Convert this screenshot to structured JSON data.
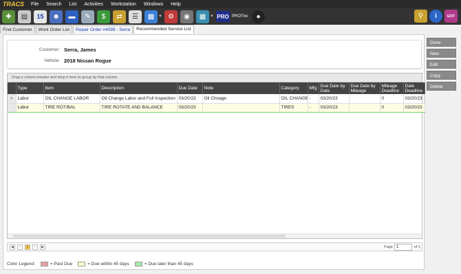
{
  "app": {
    "logo": "TRACS"
  },
  "menu": [
    "File",
    "Search",
    "List",
    "Activities",
    "Workstation",
    "Windows",
    "Help"
  ],
  "toolbar": {
    "icons": [
      "new-doc-icon",
      "clipboard-icon",
      "calendar-icon",
      "customers-icon",
      "car-icon",
      "invoice-icon",
      "money-icon",
      "transfer-icon",
      "report-icon",
      "chart-icon",
      "dyno-icon",
      "wheel-icon",
      "book-icon"
    ],
    "calendar_day": "15",
    "pro_label": "PRO",
    "protire_label": "PROTire",
    "right_icons": [
      "keys-icon",
      "info-icon",
      "exit-icon"
    ],
    "exit_label": "EXIT"
  },
  "tabs": [
    {
      "label": "Find Customer"
    },
    {
      "label": "Work Order List"
    },
    {
      "label": "Repair Order #4099 - Serra"
    },
    {
      "label": "Recommended Service List"
    }
  ],
  "header": {
    "customer_label": "Customer:",
    "customer_value": "Serra, James",
    "vehicle_label": "Vehicle:",
    "vehicle_value": "2018 Nissan Rogue"
  },
  "grid": {
    "group_hint": "Drag a column header and drop it here to group by that column",
    "columns": [
      "Type",
      "Item",
      "Description",
      "Due Date",
      "Note",
      "Category",
      "Mfg",
      "Due Date by Date",
      "Due Date by Mileage",
      "Mileage Deadline",
      "Date Deadline"
    ],
    "rows": [
      [
        "Labor",
        "OIL CHANGE LABOR",
        "Oil Change Labor and Full Inspection",
        "03/20/23",
        "Oil Chnage",
        "OIL CHANGE",
        "-",
        "03/20/23",
        "",
        "0",
        "03/20/23"
      ],
      [
        "Labor",
        "TIRE ROT/BAL",
        "TIRE ROTATE AND BALANCE",
        "03/20/23",
        "",
        "TIRES",
        "-",
        "03/20/23",
        "",
        "0",
        "03/20/23"
      ]
    ],
    "row_indicator": ">"
  },
  "pager": {
    "current": "1",
    "page_label": "Page",
    "page_value": "1",
    "of_label": "of 1"
  },
  "legend": {
    "title": "Color Legend:",
    "items": [
      {
        "label": "= Past Due",
        "color": "#e8a0a0"
      },
      {
        "label": "= Due within 45 days",
        "color": "#fdfdc8"
      },
      {
        "label": "= Due later than 45 days",
        "color": "#a8eda8"
      }
    ]
  },
  "actions": [
    "Done",
    "New",
    "Edit",
    "Copy",
    "Delete"
  ]
}
